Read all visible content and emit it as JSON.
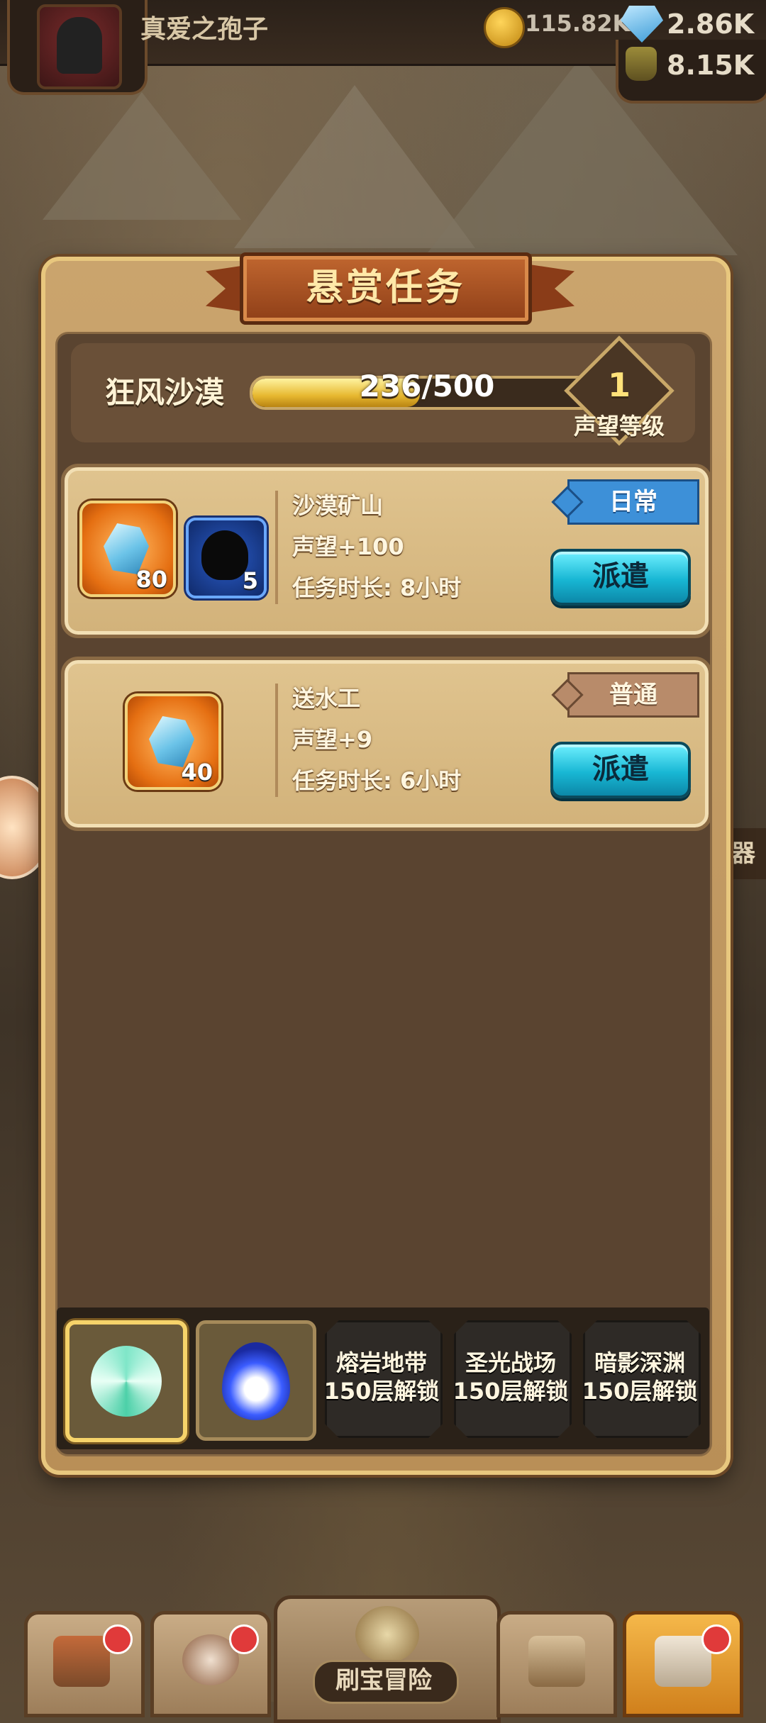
{
  "header": {
    "player_name": "真爱之孢子",
    "gold": "115.82K",
    "gems": "2.86K",
    "jar": "8.15K"
  },
  "panel": {
    "title": "悬赏任务",
    "region": "狂风沙漠",
    "reputation_current": 236,
    "reputation_max": 500,
    "reputation_text": "236/500",
    "level": "1",
    "level_label": "声望等级"
  },
  "tasks": [
    {
      "name": "沙漠矿山",
      "reputation": "声望+100",
      "duration": "任务时长: 8小时",
      "tag": "日常",
      "dispatch_label": "派遣",
      "rewards": [
        {
          "icon": "crystal-icon",
          "count": "80"
        },
        {
          "icon": "hero-silhouette-icon",
          "count": "5"
        }
      ]
    },
    {
      "name": "送水工",
      "reputation": "声望+9",
      "duration": "任务时长: 6小时",
      "tag": "普通",
      "dispatch_label": "派遣",
      "rewards": [
        {
          "icon": "crystal-icon",
          "count": "40"
        }
      ]
    }
  ],
  "region_tabs": [
    {
      "icon": "wind-icon",
      "state": "active"
    },
    {
      "icon": "water-drop-icon",
      "state": "unlocked"
    },
    {
      "name": "熔岩地带",
      "lock_text": "150层解锁",
      "state": "locked"
    },
    {
      "name": "圣光战场",
      "lock_text": "150层解锁",
      "state": "locked"
    },
    {
      "name": "暗影深渊",
      "lock_text": "150层解锁",
      "state": "locked"
    }
  ],
  "side": {
    "right_tab": "器"
  },
  "bottom_nav": {
    "center_label": "刷宝冒险",
    "items": [
      "shop-icon",
      "hero-icon",
      "adventure-icon",
      "bag-icon",
      "forge-icon"
    ]
  },
  "colors": {
    "accent_blue": "#3d90d8",
    "dispatch_cyan": "#18b7d4",
    "gold_text": "#ffe27a"
  }
}
